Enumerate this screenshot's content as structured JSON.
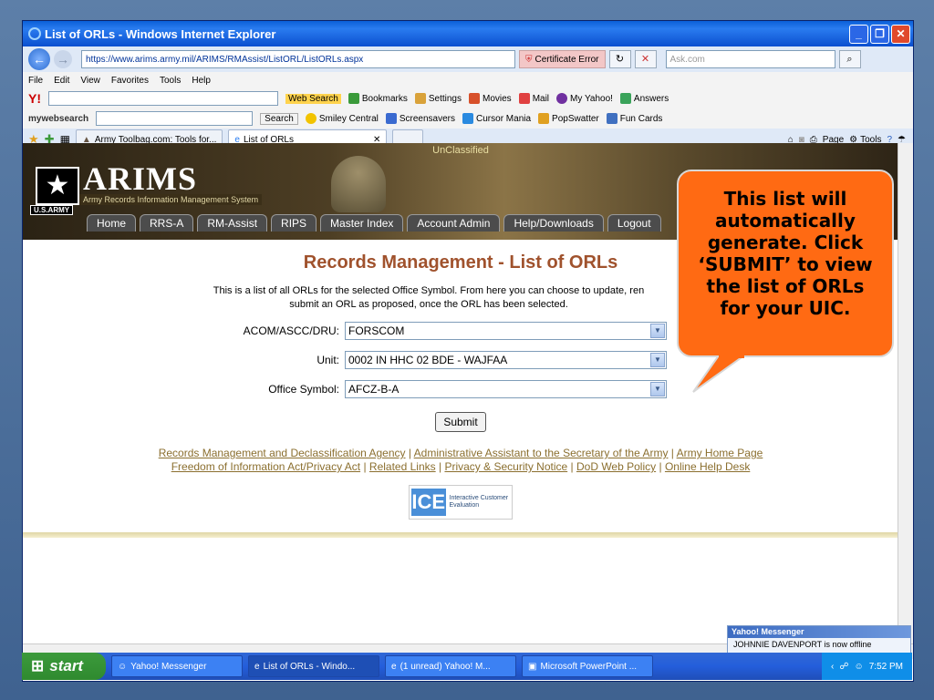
{
  "window": {
    "title": "List of ORLs - Windows Internet Explorer"
  },
  "address": {
    "url": "https://www.arims.army.mil/ARIMS/RMAssist/ListORL/ListORLs.aspx",
    "cert_error": "Certificate Error",
    "search_placeholder": "Ask.com"
  },
  "menu": [
    "File",
    "Edit",
    "View",
    "Favorites",
    "Tools",
    "Help"
  ],
  "toolbar1": {
    "web_search": "Web Search",
    "items": [
      "Bookmarks",
      "Settings",
      "Movies",
      "Mail",
      "My Yahoo!",
      "Answers"
    ]
  },
  "toolbar2": {
    "brand": "mywebsearch",
    "search_btn": "Search",
    "items": [
      "Smiley Central",
      "Screensavers",
      "Cursor Mania",
      "PopSwatter",
      "Fun Cards"
    ]
  },
  "tabs": [
    {
      "label": "Army Toolbag.com: Tools for..."
    },
    {
      "label": "List of ORLs"
    }
  ],
  "cmd": {
    "page": "Page",
    "tools": "Tools"
  },
  "banner": {
    "classification": "UnClassified",
    "logo": "ARIMS",
    "logo_sub": "Army Records Information Management System",
    "usarmy": "U.S.ARMY",
    "nav": [
      "Home",
      "RRS-A",
      "RM-Assist",
      "RIPS",
      "Master Index",
      "Account Admin",
      "Help/Downloads",
      "Logout"
    ]
  },
  "page": {
    "title": "Records Management - List of ORLs",
    "intro1": "This is a list of all ORLs for the selected Office Symbol. From here you can choose to update, ren",
    "intro2": "submit an ORL as proposed, once the ORL has been selected."
  },
  "form": {
    "acom": {
      "label": "ACOM/ASCC/DRU:",
      "value": "FORSCOM"
    },
    "unit": {
      "label": "Unit:",
      "value": "0002 IN HHC 02 BDE - WAJFAA"
    },
    "office": {
      "label": "Office Symbol:",
      "value": "AFCZ-B-A"
    },
    "submit": "Submit"
  },
  "links": {
    "row1": [
      "Records Management and Declassification Agency",
      "Administrative Assistant to the Secretary of the Army",
      "Army Home Page"
    ],
    "row2": [
      "Freedom of Information Act/Privacy Act",
      "Related Links",
      "Privacy & Security Notice",
      "DoD Web Policy",
      "Online Help Desk"
    ],
    "sep": "|"
  },
  "ice": {
    "logo": "ICE",
    "text": "Interactive Customer Evaluation"
  },
  "callout": {
    "text": "This list will automatically generate. Click ‘SUBMIT’ to view the list of ORLs for your UIC.",
    "color": "#ff6a13"
  },
  "messenger": {
    "header": "Yahoo! Messenger",
    "body": "JOHNNIE DAVENPORT is now offline"
  },
  "taskbar": {
    "start": "start",
    "items": [
      "Yahoo! Messenger",
      "List of ORLs - Windo...",
      "(1 unread) Yahoo! M...",
      "Microsoft PowerPoint ..."
    ],
    "clock": "7:52 PM"
  }
}
